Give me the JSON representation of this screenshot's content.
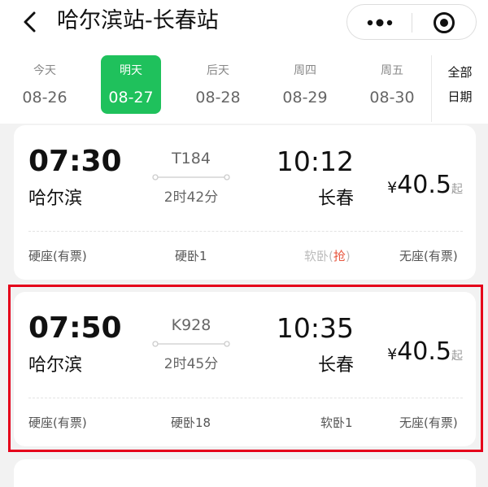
{
  "header": {
    "title": "哈尔滨站-长春站"
  },
  "dates": [
    {
      "weekday": "今天",
      "date": "08-26",
      "active": false
    },
    {
      "weekday": "明天",
      "date": "08-27",
      "active": true
    },
    {
      "weekday": "后天",
      "date": "08-28",
      "active": false
    },
    {
      "weekday": "周四",
      "date": "08-29",
      "active": false
    },
    {
      "weekday": "周五",
      "date": "08-30",
      "active": false
    }
  ],
  "all_dates": {
    "line1": "全部",
    "line2": "日期"
  },
  "trains": [
    {
      "departure_time": "07:30",
      "departure_station": "哈尔滨",
      "train_number": "T184",
      "duration": "2时42分",
      "arrival_time": "10:12",
      "arrival_station": "长春",
      "price_symbol": "¥",
      "price": "40.5",
      "price_suffix": "起",
      "seats": {
        "s1": "硬座(有票)",
        "s2": "硬卧1",
        "s3_main": "软卧",
        "s3_paren_open": "(",
        "s3_status": "抢",
        "s3_paren_close": ")",
        "s4": "无座(有票)"
      }
    },
    {
      "departure_time": "07:50",
      "departure_station": "哈尔滨",
      "train_number": "K928",
      "duration": "2时45分",
      "arrival_time": "10:35",
      "arrival_station": "长春",
      "price_symbol": "¥",
      "price": "40.5",
      "price_suffix": "起",
      "seats": {
        "s1": "硬座(有票)",
        "s2": "硬卧18",
        "s3": "软卧1",
        "s4": "无座(有票)"
      }
    }
  ],
  "colors": {
    "accent": "#1fc15c",
    "highlight": "#e5001a",
    "grab": "#e8573f"
  }
}
